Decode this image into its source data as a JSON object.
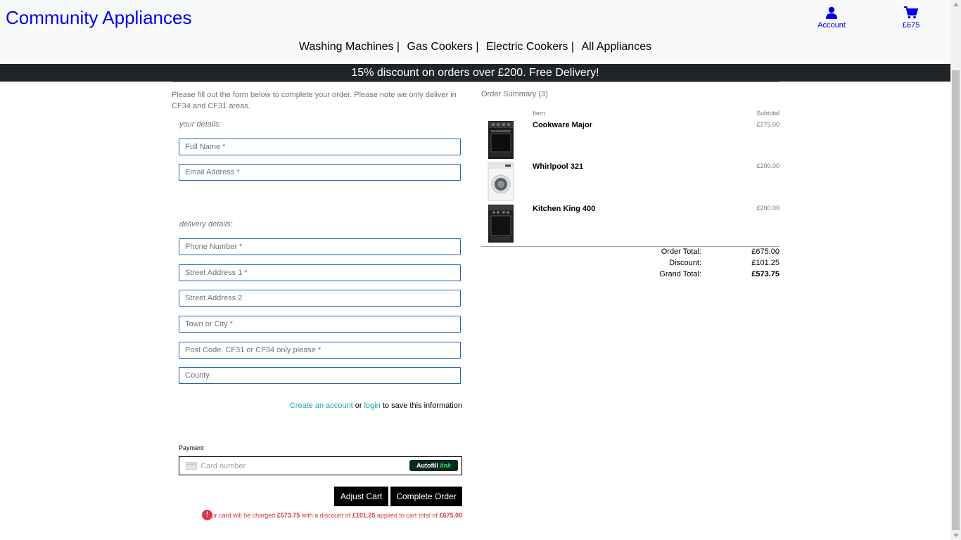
{
  "header": {
    "brand": "Community Appliances",
    "account_label": "Account",
    "cart_total": "£675",
    "nav": [
      "Washing Machines |",
      "Gas Cookers |",
      "Electric Cookers |",
      "All Appliances"
    ]
  },
  "banner": "15% discount on orders over £200. Free Delivery!",
  "form": {
    "intro": "Please fill out the form below to complete your order. Please note we only deliver in CF34 and CF31 areas.",
    "your_details_legend": "your details:",
    "full_name_placeholder": "Full Name *",
    "email_placeholder": "Email Address *",
    "delivery_legend": "delivery details:",
    "phone_placeholder": "Phone Number *",
    "street1_placeholder": "Street Address 1 *",
    "street2_placeholder": "Street Address 2",
    "town_placeholder": "Town or City *",
    "postcode_placeholder": "Post Code. CF31 or CF34 only please *",
    "county_placeholder": "County",
    "create_account_link": "Create an account",
    "or_text": "or",
    "login_link": "login",
    "save_suffix": "to save this information",
    "payment_label": "Payment",
    "card_placeholder": "Card number",
    "autofill_text": "Autofill",
    "autofill_link": "link",
    "adjust_cart": "Adjust Cart",
    "complete_order": "Complete Order",
    "warning": {
      "icon": "!",
      "text1": "your card will be charged",
      "charge": "£573.75",
      "text2": "with a discount of",
      "discount": "£101.25",
      "text3": "applied to cart total of",
      "total": "£675.00"
    }
  },
  "summary": {
    "title": "Order Summary (3)",
    "col_item": "Item",
    "col_subtotal": "Subtotal",
    "items": [
      {
        "name": "Cookware Major",
        "price": "£275.00",
        "icon": "cooker-icon"
      },
      {
        "name": "Whirlpool 321",
        "price": "£200.00",
        "icon": "washing-machine-icon"
      },
      {
        "name": "Kitchen King 400",
        "price": "£200.00",
        "icon": "cooker-icon"
      }
    ],
    "order_total_label": "Order Total:",
    "order_total": "£675.00",
    "discount_label": "Discount:",
    "discount": "£101.25",
    "grand_total_label": "Grand Total:",
    "grand_total": "£573.75"
  },
  "colors": {
    "link_blue": "#0000ee",
    "field_border": "#1e62b9",
    "banner_bg": "#212529",
    "teal_link": "#17a2b8",
    "warning_red": "#dc3545"
  }
}
